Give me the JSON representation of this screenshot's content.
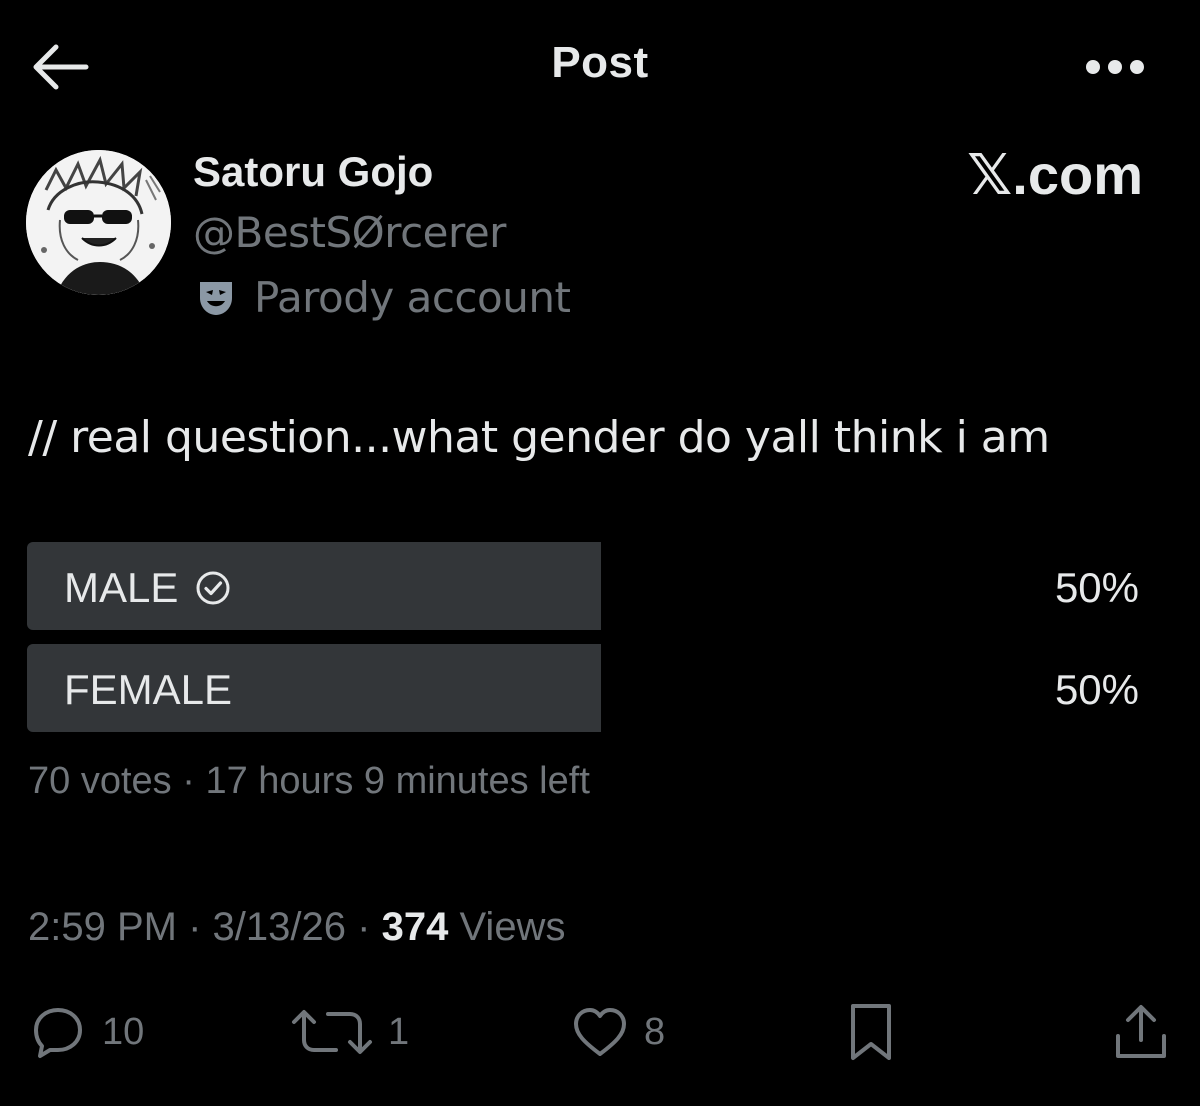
{
  "header": {
    "title": "Post",
    "back_icon": "arrow-left-icon",
    "more_icon": "more-horizontal-icon"
  },
  "author": {
    "display_name": "Satoru Gojo",
    "handle": "@BestSØrcerer",
    "parody_label": "Parody account",
    "parody_icon": "theater-mask-icon"
  },
  "watermark": "𝕏.com",
  "post": {
    "text": "// real question...what gender do yall think i am"
  },
  "poll": {
    "options": [
      {
        "label": "MALE",
        "percent_label": "50%",
        "percent": 50,
        "selected": true
      },
      {
        "label": "FEMALE",
        "percent_label": "50%",
        "percent": 50,
        "selected": false
      }
    ],
    "votes": "70 votes",
    "separator": "·",
    "time_left": "17 hours 9 minutes left"
  },
  "meta": {
    "time": "2:59 PM",
    "separator": "·",
    "date": "3/13/26",
    "views_count": "374",
    "views_label": "Views"
  },
  "actions": {
    "reply_count": "10",
    "repost_count": "1",
    "like_count": "8"
  },
  "colors": {
    "background": "#000000",
    "text_primary": "#e7e9ea",
    "text_secondary": "#71767b",
    "poll_bar": "#333639"
  }
}
